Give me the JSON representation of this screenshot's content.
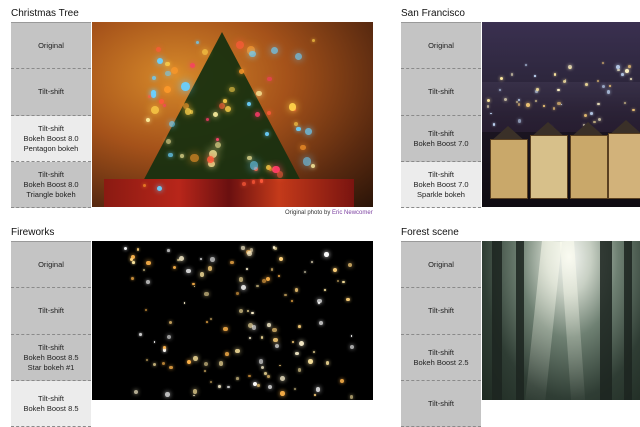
{
  "panels": [
    {
      "title": "Christmas Tree",
      "items": [
        "Original",
        "Tilt-shift",
        "Tilt-shift\nBokeh Boost 8.0\nPentagon bokeh",
        "Tilt-shift\nBokeh Boost 8.0\nTriangle bokeh"
      ],
      "active_index": 2,
      "credit_prefix": "Original photo by",
      "credit_link": "Eric Newcomer"
    },
    {
      "title": "San Francisco",
      "items": [
        "Original",
        "Tilt-shift",
        "Tilt-shift\nBokeh Boost 7.0",
        "Tilt-shift\nBokeh Boost 7.0\nSparkle bokeh"
      ],
      "active_index": 3
    },
    {
      "title": "Fireworks",
      "items": [
        "Original",
        "Tilt-shift",
        "Tilt-shift\nBokeh Boost 8.5\nStar bokeh #1",
        "Tilt-shift\nBokeh Boost 8.5"
      ],
      "active_index": 3
    },
    {
      "title": "Forest scene",
      "items": [
        "Original",
        "Tilt-shift",
        "Tilt-shift\nBokeh Boost 2.5",
        "Tilt-shift"
      ],
      "active_index": -1
    }
  ]
}
